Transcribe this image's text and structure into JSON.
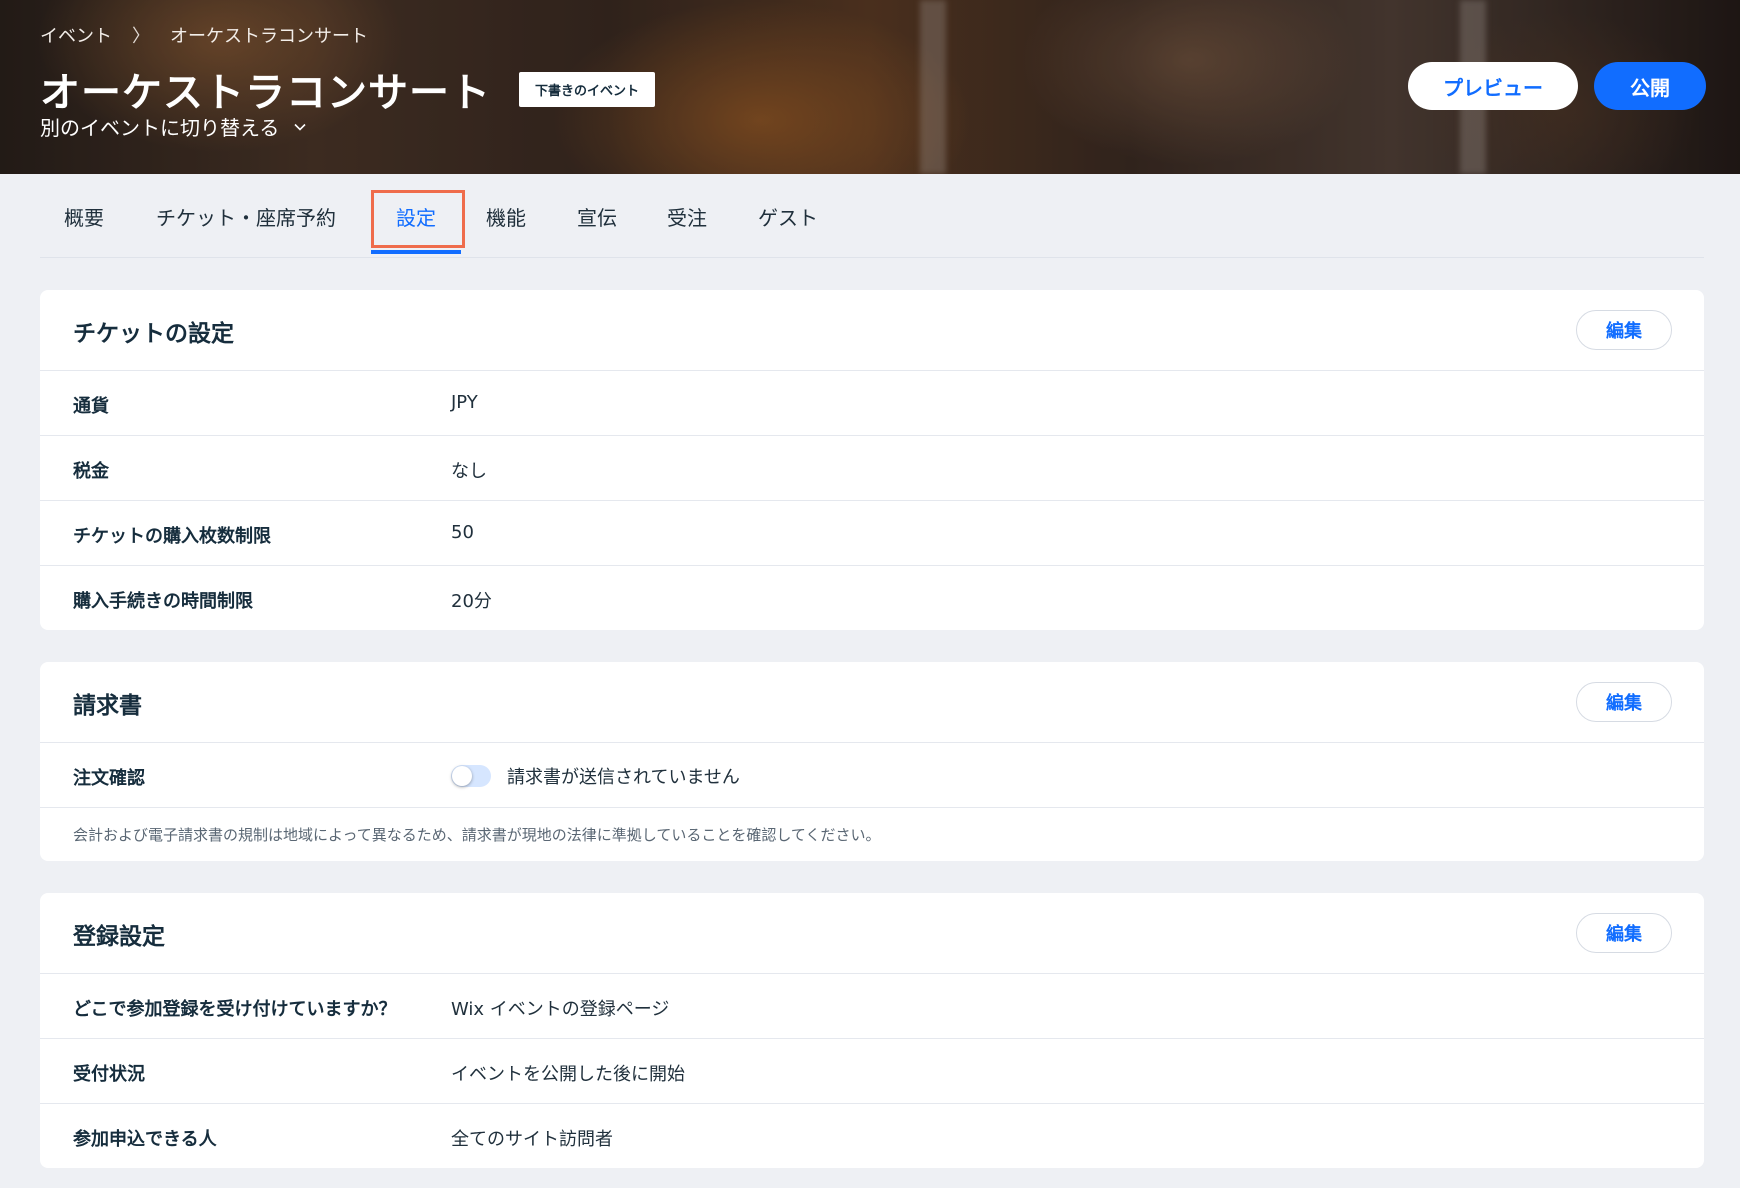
{
  "breadcrumb": {
    "items": [
      "イベント",
      "オーケストラコンサート"
    ],
    "separator": "〉"
  },
  "header": {
    "title": "オーケストラコンサート",
    "status_badge": "下書きのイベント",
    "switch_event": "別のイベントに切り替える",
    "preview_label": "プレビュー",
    "publish_label": "公開"
  },
  "tabs": [
    {
      "label": "概要"
    },
    {
      "label": "チケット・座席予約"
    },
    {
      "label": "設定",
      "active": true
    },
    {
      "label": "機能"
    },
    {
      "label": "宣伝"
    },
    {
      "label": "受注"
    },
    {
      "label": "ゲスト"
    }
  ],
  "ticket_settings": {
    "title": "チケットの設定",
    "edit_label": "編集",
    "rows": [
      {
        "label": "通貨",
        "value": "JPY"
      },
      {
        "label": "税金",
        "value": "なし"
      },
      {
        "label": "チケットの購入枚数制限",
        "value": "50"
      },
      {
        "label": "購入手続きの時間制限",
        "value": "20分"
      }
    ]
  },
  "invoice": {
    "title": "請求書",
    "edit_label": "編集",
    "order_confirmation_label": "注文確認",
    "toggle_on": false,
    "toggle_text": "請求書が送信されていません",
    "note": "会計および電子請求書の規制は地域によって異なるため、請求書が現地の法律に準拠していることを確認してください。"
  },
  "registration": {
    "title": "登録設定",
    "edit_label": "編集",
    "rows": [
      {
        "label": "どこで参加登録を受け付けていますか？",
        "value": "Wix イベントの登録ページ"
      },
      {
        "label": "受付状況",
        "value": "イベントを公開した後に開始"
      },
      {
        "label": "参加申込できる人",
        "value": "全てのサイト訪問者"
      }
    ]
  },
  "colors": {
    "accent": "#116dff",
    "highlight_box": "#ef6c4b",
    "page_background": "#eef0f4"
  }
}
